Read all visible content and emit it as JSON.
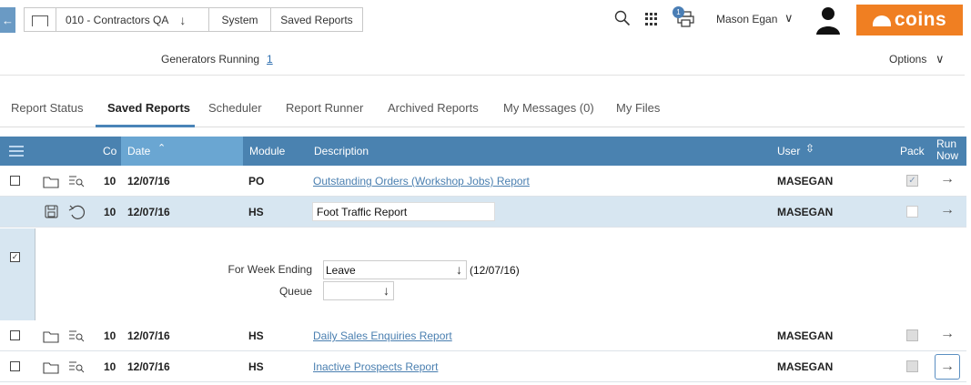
{
  "breadcrumb": {
    "company": "010 - Contractors QA",
    "system": "System",
    "saved_reports": "Saved Reports"
  },
  "header": {
    "notification_count": "1",
    "user_name": "Mason Egan",
    "logo_text": "coins"
  },
  "status": {
    "generators_label": "Generators Running",
    "generators_count": "1",
    "options_label": "Options"
  },
  "tabs": [
    {
      "label": "Report Status"
    },
    {
      "label": "Saved Reports"
    },
    {
      "label": "Scheduler"
    },
    {
      "label": "Report Runner"
    },
    {
      "label": "Archived Reports"
    },
    {
      "label": "My Messages (0)"
    },
    {
      "label": "My Files"
    }
  ],
  "table": {
    "columns": {
      "co": "Co",
      "date": "Date",
      "module": "Module",
      "description": "Description",
      "user": "User",
      "pack": "Pack",
      "run_now": "Run Now"
    },
    "rows": [
      {
        "co": "10",
        "date": "12/07/16",
        "module": "PO",
        "description": "Outstanding Orders (Workshop Jobs) Report",
        "user": "MASEGAN",
        "pack": true
      },
      {
        "co": "10",
        "date": "12/07/16",
        "module": "HS",
        "description": "Foot Traffic Report",
        "user": "MASEGAN",
        "pack": false
      },
      {
        "co": "10",
        "date": "12/07/16",
        "module": "HS",
        "description": "Daily Sales Enquiries Report",
        "user": "MASEGAN",
        "pack": false
      },
      {
        "co": "10",
        "date": "12/07/16",
        "module": "HS",
        "description": "Inactive Prospects Report",
        "user": "MASEGAN",
        "pack": false
      }
    ]
  },
  "params": {
    "week_ending_label": "For Week Ending",
    "week_ending_value": "Leave",
    "week_ending_date": "(12/07/16)",
    "queue_label": "Queue",
    "queue_value": ""
  },
  "colors": {
    "accent": "#4a82b0",
    "header_highlight": "#6aa6d2",
    "logo": "#f07f22",
    "selected_row": "#d7e6f1"
  }
}
